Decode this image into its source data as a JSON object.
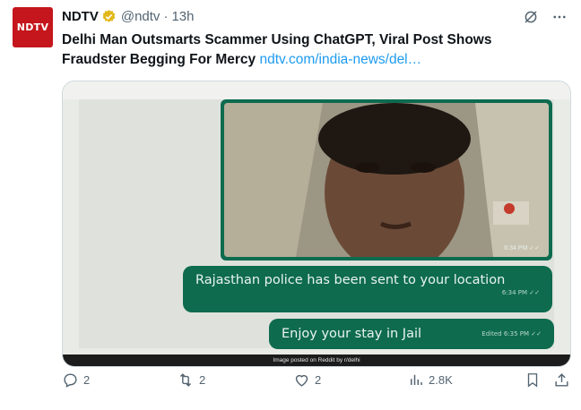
{
  "tweet": {
    "avatar_text": "NDTV",
    "author_name": "NDTV",
    "handle": "@ndtv",
    "separator": "·",
    "time": "13h",
    "headline": "Delhi Man Outsmarts Scammer Using ChatGPT, Viral Post Shows Fraudster Begging For Mercy",
    "link_text": "ndtv.com/india-news/del…",
    "accent_color": "#1d9bf0",
    "verified_color": "#e2b719"
  },
  "media": {
    "photo_timestamp": "6:34 PM ✓✓",
    "bubble1_text": "Rajasthan police has been sent to your location",
    "bubble1_meta": "6:34 PM ✓✓",
    "bubble2_text": "Enjoy your stay in Jail",
    "bubble2_meta": "Edited 6:35 PM ✓✓",
    "caption": "Image posted on Reddit by r/delhi"
  },
  "actions": {
    "reply_count": "2",
    "retweet_count": "2",
    "like_count": "2",
    "views_count": "2.8K"
  },
  "icons": [
    "grok-icon",
    "more-icon",
    "reply-icon",
    "retweet-icon",
    "like-icon",
    "views-icon",
    "bookmark-icon",
    "share-icon",
    "verified-icon"
  ]
}
